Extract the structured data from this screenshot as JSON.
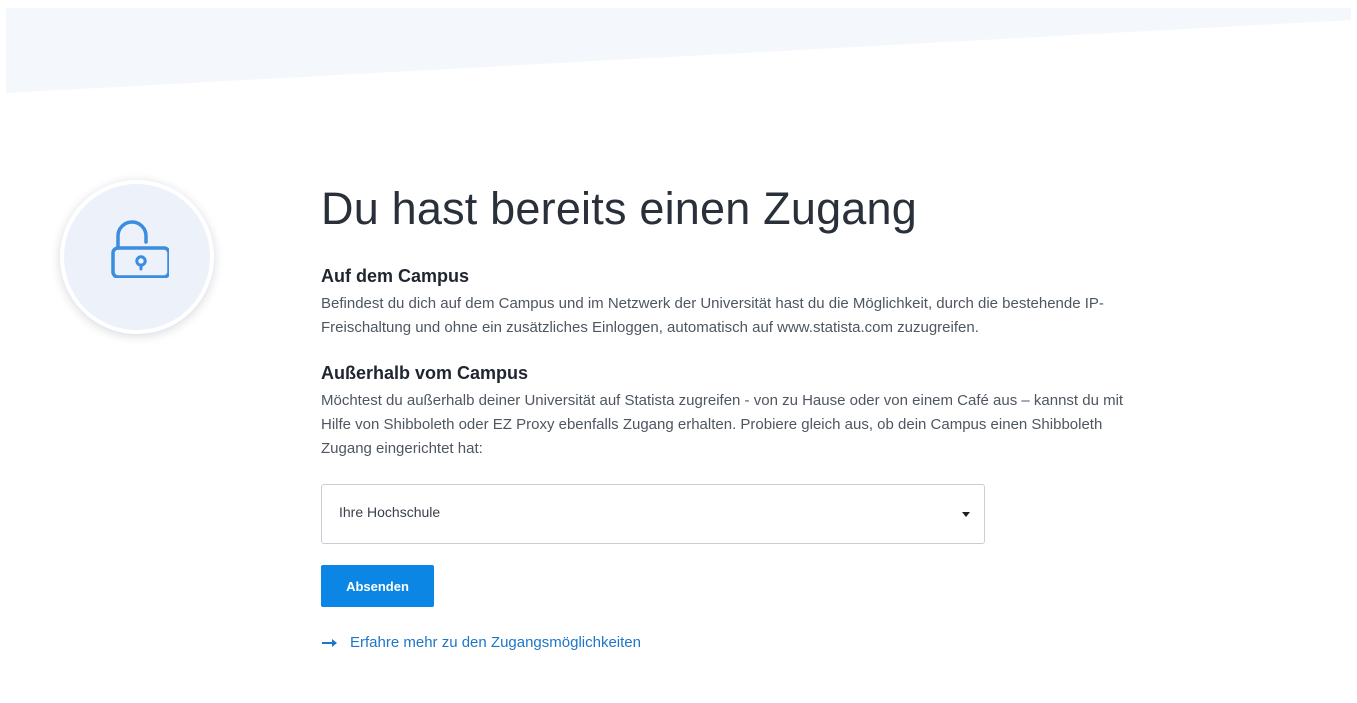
{
  "colors": {
    "accent": "#0b86e5",
    "link": "#1e76c8",
    "lock_icon": "#3b8de0",
    "badge_background": "#edf1f9",
    "top_band": "#f4f7fb"
  },
  "icons": {
    "lock": "lock-icon",
    "arrow": "arrow-right-icon"
  },
  "main": {
    "title": "Du hast bereits einen Zugang",
    "on_campus": {
      "heading": "Auf dem Campus",
      "text": "Befindest du dich auf dem Campus und im Netzwerk der Universität hast du die Möglichkeit, durch die bestehende IP-Freischaltung und ohne ein zusätzliches Einloggen, automatisch auf www.statista.com zuzugreifen."
    },
    "off_campus": {
      "heading": "Außerhalb vom Campus",
      "text": "Möchtest du außerhalb deiner Universität auf Statista zugreifen - von zu Hause oder von einem Café aus – kannst du mit Hilfe von Shibboleth oder EZ Proxy ebenfalls Zugang erhalten. Probiere gleich aus, ob dein Campus einen Shibboleth Zugang eingerichtet hat:"
    },
    "university_select": {
      "selected": "Ihre Hochschule"
    },
    "submit_label": "Absenden",
    "learn_more_label": "Erfahre mehr zu den Zugangsmöglichkeiten"
  }
}
